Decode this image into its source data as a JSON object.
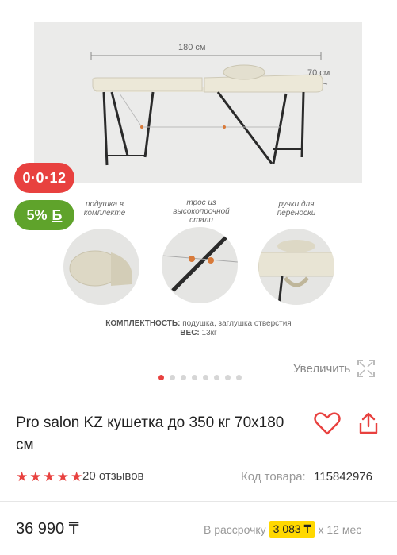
{
  "gallery": {
    "dimension_length": "180 см",
    "dimension_width": "70 см",
    "badge_timer": "0·0·12",
    "badge_bonus_percent": "5%",
    "badge_bonus_letter": "Б",
    "features": [
      {
        "caption": "подушка в\nкомплекте"
      },
      {
        "caption": "трос из\nвысокопрочной\nстали"
      },
      {
        "caption": "ручки для\nпереноски"
      }
    ],
    "spec_line1_label": "КОМПЛЕКТНОСТЬ:",
    "spec_line1_value": " подушка, заглушка отверстия",
    "spec_line2_label": "ВЕС:",
    "spec_line2_value": " 13кг",
    "dot_count": 8,
    "active_dot": 0,
    "zoom_label": "Увеличить"
  },
  "product": {
    "title": "Pro salon KZ кушетка до 350 кг 70х180 см",
    "rating_stars": 5,
    "reviews": "20 отзывов",
    "sku_label": "Код товара:",
    "sku_value": "115842976"
  },
  "pricing": {
    "price": "36 990 ₸",
    "installment_prefix": "В рассрочку",
    "installment_amount": "3 083 ₸",
    "installment_suffix": "х 12 мес"
  },
  "colors": {
    "accent": "#e8413f",
    "bonus": "#5fa32b",
    "highlight": "#ffd800"
  },
  "icons": [
    "heart-icon",
    "share-icon",
    "expand-icon",
    "star-icon"
  ]
}
